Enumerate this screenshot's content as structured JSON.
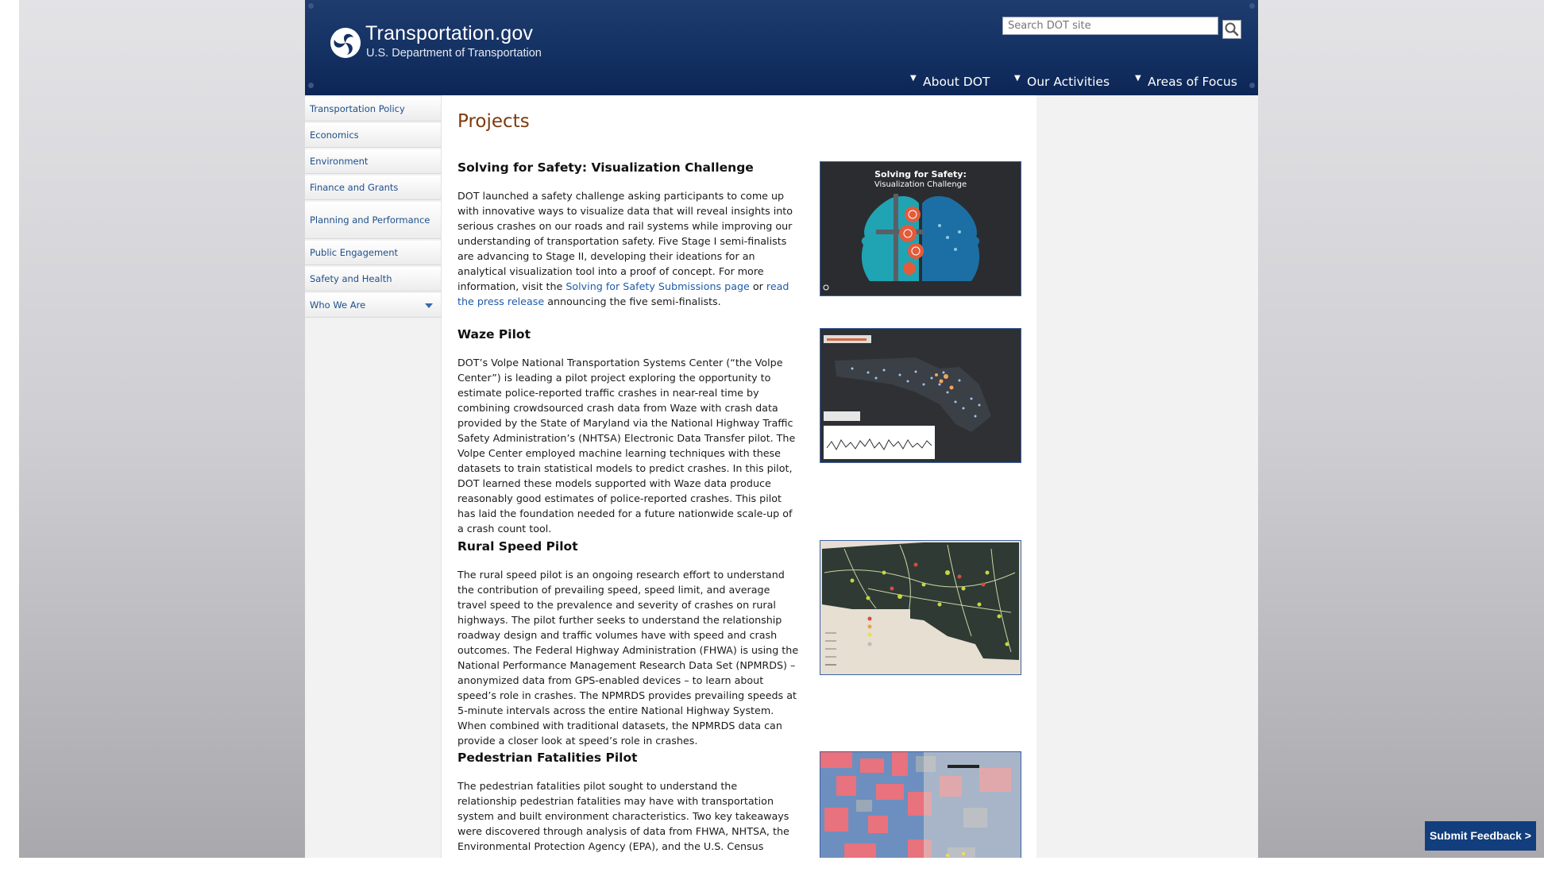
{
  "header": {
    "site_name": "Transportation.gov",
    "site_subtitle": "U.S. Department of Transportation",
    "search_placeholder": "Search DOT site",
    "logo_icon": "dot-triskelion-logo-icon",
    "search_icon": "magnifier-icon"
  },
  "topnav": [
    {
      "label": "About DOT"
    },
    {
      "label": "Our Activities"
    },
    {
      "label": "Areas of Focus"
    }
  ],
  "sidebar": {
    "items": [
      {
        "label": "Transportation Policy"
      },
      {
        "label": "Economics"
      },
      {
        "label": "Environment"
      },
      {
        "label": "Finance and Grants"
      },
      {
        "label": "Planning and Performance"
      },
      {
        "label": "Public Engagement"
      },
      {
        "label": "Safety and Health"
      },
      {
        "label": "Who We Are"
      }
    ]
  },
  "main": {
    "title": "Projects",
    "projects": [
      {
        "title": "Solving for Safety: Visualization Challenge",
        "body_before": "DOT launched a safety challenge asking participants to come up with innovative ways to visualize data that will reveal insights into serious crashes on our roads and rail systems while improving our understanding of transportation safety. Five Stage I semi-finalists are advancing to Stage II, developing their ideations for an analytical visualization tool into a proof of concept. For more information, visit the ",
        "link1": "Solving for Safety Submissions page",
        "middle": " or ",
        "link2": "read the press release",
        "body_after": " announcing the five semi-finalists.",
        "thumb_title": "Solving for Safety:",
        "thumb_subtitle": "Visualization Challenge"
      },
      {
        "title": "Waze Pilot",
        "body": "DOT’s Volpe National Transportation Systems Center (“the Volpe Center”) is leading a pilot project exploring the opportunity to estimate police-reported traffic crashes in near-real time by combining crowdsourced crash data from Waze with crash data provided by the State of Maryland via the National Highway Traffic Safety Administration’s (NHTSA) Electronic Data Transfer pilot. The Volpe Center employed machine learning techniques with these datasets to train statistical models to predict crashes. In this pilot, DOT learned these models supported with Waze data produce reasonably good estimates of police-reported crashes. This pilot has laid the foundation needed for a future nationwide scale-up of a crash count tool."
      },
      {
        "title": "Rural Speed Pilot",
        "body": "The rural speed pilot is an ongoing research effort to understand the contribution of prevailing speed, speed limit, and average travel speed to the prevalence and severity of crashes on rural highways. The pilot further seeks to understand the relationship roadway design and traffic volumes have with speed and crash outcomes. The Federal Highway Administration (FHWA) is using the National Performance Management Research Data Set (NPMRDS) – anonymized data from GPS-enabled devices – to learn about speed’s role in crashes. The NPMRDS provides prevailing speeds at 5-minute intervals across the entire National Highway System. When combined with traditional datasets, the NPMRDS data can provide a closer look at speed’s role in crashes."
      },
      {
        "title": "Pedestrian Fatalities Pilot",
        "body": "The pedestrian fatalities pilot sought to understand the relationship pedestrian fatalities may have with transportation system and built environment characteristics. Two key takeaways were discovered through analysis of data from FHWA, NHTSA, the Environmental Protection Agency (EPA), and the U.S. Census"
      }
    ]
  },
  "feedback_button": "Submit Feedback >",
  "colors": {
    "header_blue": "#143163",
    "title_brown": "#7c3a0d",
    "link_blue": "#1f5aa8",
    "feedback_bg": "#123e7e"
  }
}
